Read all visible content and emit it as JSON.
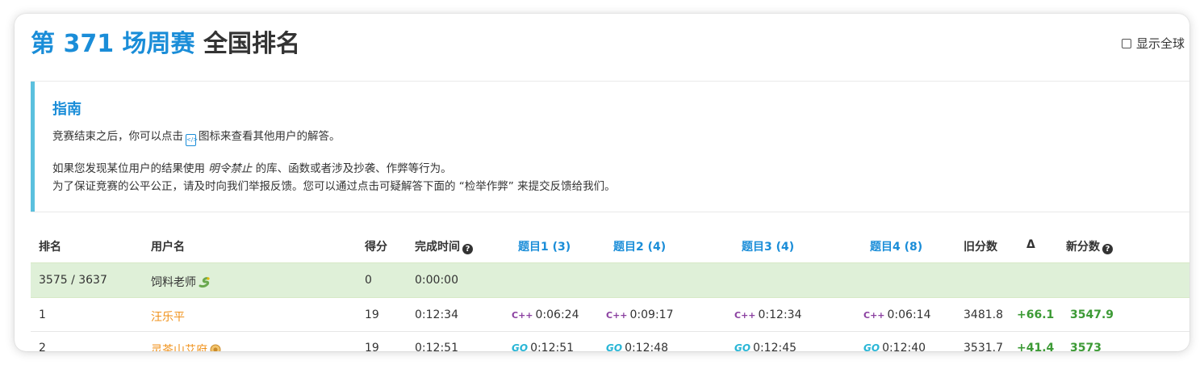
{
  "header": {
    "title_contest": "第 371 场周赛",
    "title_rank": "全国排名",
    "toggle_label": "显示全球"
  },
  "guide": {
    "heading": "指南",
    "line1_before": "竞赛结束之后，你可以点击",
    "line1_after": "图标来查看其他用户的解答。",
    "line2_before": "如果您发现某位用户的结果使用",
    "line2_em": "明令禁止",
    "line2_after": "的库、函数或者涉及抄袭、作弊等行为。",
    "line3": "为了保证竞赛的公平公正，请及时向我们举报反馈。您可以通过点击可疑解答下面的 “检举作弊” 来提交反馈给我们。"
  },
  "table": {
    "columns": [
      "排名",
      "用户名",
      "得分",
      "完成时间",
      "题目1 (3)",
      "题目2 (4)",
      "题目3 (4)",
      "题目4 (8)",
      "旧分数",
      "Δ",
      "新分数"
    ],
    "self_row": {
      "rank": "3575 / 3637",
      "username": "饲料老师",
      "score": "0",
      "time": "0:00:00"
    },
    "rows": [
      {
        "rank": "1",
        "username": "汪乐平",
        "score": "19",
        "time": "0:12:34",
        "q1": "0:06:24",
        "q2": "0:09:17",
        "q3": "0:12:34",
        "q4": "0:06:14",
        "lang": "C++",
        "old": "3481.8",
        "delta": "+66.1",
        "new": "3547.9"
      },
      {
        "rank": "2",
        "username": "灵茶山艾府",
        "score": "19",
        "time": "0:12:51",
        "q1": "0:12:51",
        "q2": "0:12:48",
        "q3": "0:12:45",
        "q4": "0:12:40",
        "lang": "GO",
        "old": "3531.7",
        "delta": "+41.4",
        "new": "3573"
      }
    ]
  },
  "colors": {
    "accent": "#1a8dd8",
    "self_row_bg": "#dff0d8",
    "guide_border": "#5bc0de",
    "delta": "#3c9a35",
    "username": "#f0921b",
    "cpp": "#8a3fa0",
    "go": "#29b6d6"
  },
  "icons": {
    "code": "code-file-icon",
    "help": "question-circle-icon",
    "snake": "snake-emoji-icon",
    "avatar": "badge-emoji-icon"
  }
}
